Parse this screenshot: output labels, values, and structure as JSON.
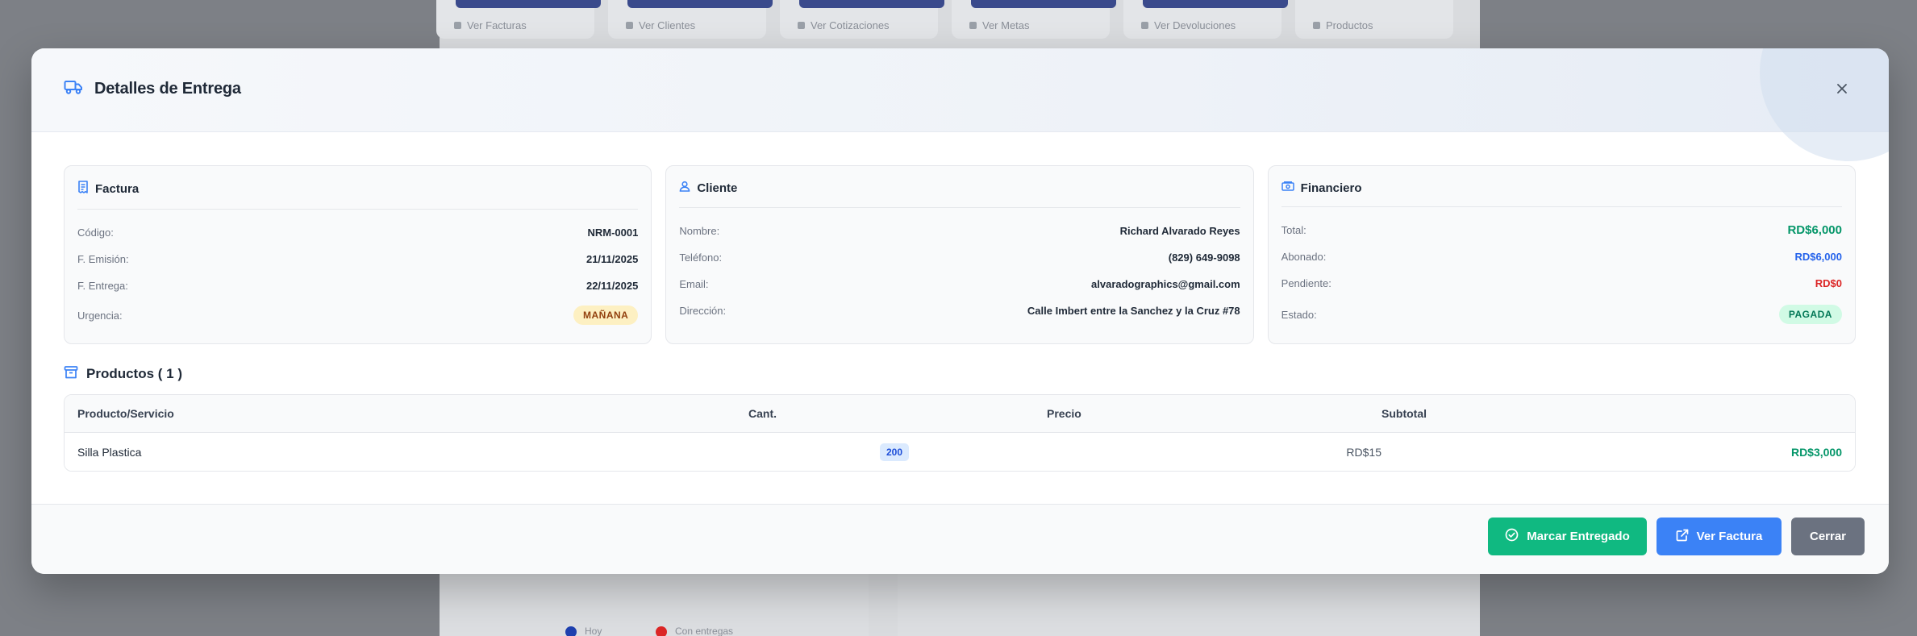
{
  "background": {
    "cards": [
      "Ver Facturas",
      "Ver Clientes",
      "Ver Cotizaciones",
      "Ver Metas",
      "Ver Devoluciones",
      "Productos"
    ],
    "legend": [
      {
        "label": "Hoy",
        "color": "#1e40af"
      },
      {
        "label": "Con entregas",
        "color": "#dc2626"
      }
    ]
  },
  "modal": {
    "title": "Detalles de Entrega",
    "title_icon": "truck-icon",
    "close_icon": "close-icon"
  },
  "factura": {
    "title": "Factura",
    "rows": [
      {
        "label": "Código:",
        "value": "NRM-0001"
      },
      {
        "label": "F. Emisión:",
        "value": "21/11/2025"
      },
      {
        "label": "F. Entrega:",
        "value": "22/11/2025"
      }
    ],
    "urgencia_label": "Urgencia:",
    "urgencia_value": "MAÑANA"
  },
  "cliente": {
    "title": "Cliente",
    "rows": [
      {
        "label": "Nombre:",
        "value": "Richard Alvarado Reyes"
      },
      {
        "label": "Teléfono:",
        "value": "(829) 649-9098"
      },
      {
        "label": "Email:",
        "value": "alvaradographics@gmail.com"
      },
      {
        "label": "Dirección:",
        "value": "Calle Imbert entre la Sanchez y la Cruz #78"
      }
    ]
  },
  "financiero": {
    "title": "Financiero",
    "total_label": "Total:",
    "total_value": "RD$6,000",
    "abonado_label": "Abonado:",
    "abonado_value": "RD$6,000",
    "pendiente_label": "Pendiente:",
    "pendiente_value": "RD$0",
    "estado_label": "Estado:",
    "estado_value": "PAGADA"
  },
  "productos": {
    "title": "Productos ( 1 )",
    "columns": [
      "Producto/Servicio",
      "Cant.",
      "Precio",
      "Subtotal"
    ],
    "rows": [
      {
        "producto": "Silla Plastica",
        "cantidad": "200",
        "precio": "RD$15",
        "subtotal": "RD$3,000"
      }
    ]
  },
  "footer": {
    "marcar": "Marcar Entregado",
    "ver_factura": "Ver Factura",
    "cerrar": "Cerrar"
  },
  "colors": {
    "primary": "#3b82f6",
    "success": "#10b981",
    "danger": "#dc2626",
    "neutral": "#6b7280"
  }
}
